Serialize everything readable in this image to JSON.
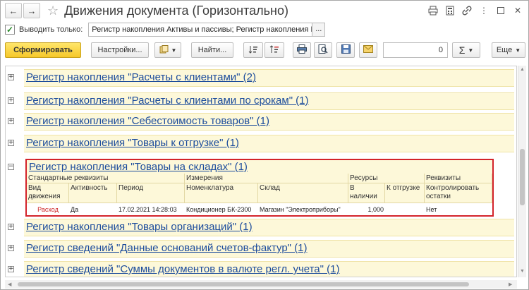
{
  "window": {
    "title": "Движения документа (Горизонтально)"
  },
  "filter": {
    "checkbox_checked": true,
    "label": "Выводить только:",
    "value": "Регистр накопления Активы и пассивы; Регистр накопления Вы",
    "more": "..."
  },
  "toolbar": {
    "generate": "Сформировать",
    "settings": "Настройки...",
    "find": "Найти...",
    "number_value": "0",
    "sigma": "Σ",
    "more": "Еще"
  },
  "groups": [
    {
      "label": "Регистр накопления \"Расчеты с клиентами\" (2)",
      "expanded": false
    },
    {
      "label": "Регистр накопления \"Расчеты с клиентами по срокам\" (1)",
      "expanded": false
    },
    {
      "label": "Регистр накопления \"Себестоимость товаров\" (1)",
      "expanded": false
    },
    {
      "label": "Регистр накопления \"Товары к отгрузке\" (1)",
      "expanded": false
    },
    {
      "label": "Регистр накопления \"Товары на складах\" (1)",
      "expanded": true
    },
    {
      "label": "Регистр накопления \"Товары организаций\" (1)",
      "expanded": false
    },
    {
      "label": "Регистр сведений \"Данные оснований счетов-фактур\" (1)",
      "expanded": false
    },
    {
      "label": "Регистр сведений \"Суммы документов в валюте регл. учета\" (1)",
      "expanded": false
    }
  ],
  "expanded_register": {
    "section_headers": {
      "standard": "Стандартные реквизиты",
      "dimensions": "Измерения",
      "resources": "Ресурсы",
      "attributes": "Реквизиты"
    },
    "columns": {
      "movement_type": "Вид движения",
      "activity": "Активность",
      "period": "Период",
      "nomenclature": "Номенклатура",
      "warehouse": "Склад",
      "in_stock": "В наличии",
      "to_ship": "К отгрузке",
      "check_balance": "Контролировать остатки"
    },
    "row": {
      "movement_type": "Расход",
      "activity": "Да",
      "period": "17.02.2021 14:28:03",
      "nomenclature": "Кондиционер БК-2300",
      "warehouse": "Магазин \"Электроприборы\"",
      "in_stock": "1,000",
      "to_ship": "",
      "check_balance": "Нет"
    }
  },
  "colors": {
    "link": "#1c4c9c",
    "band": "#fdf8d9",
    "highlight_border": "#d3232a",
    "primary_button": "#f6c82a",
    "expense_text": "#cc1f1f"
  }
}
